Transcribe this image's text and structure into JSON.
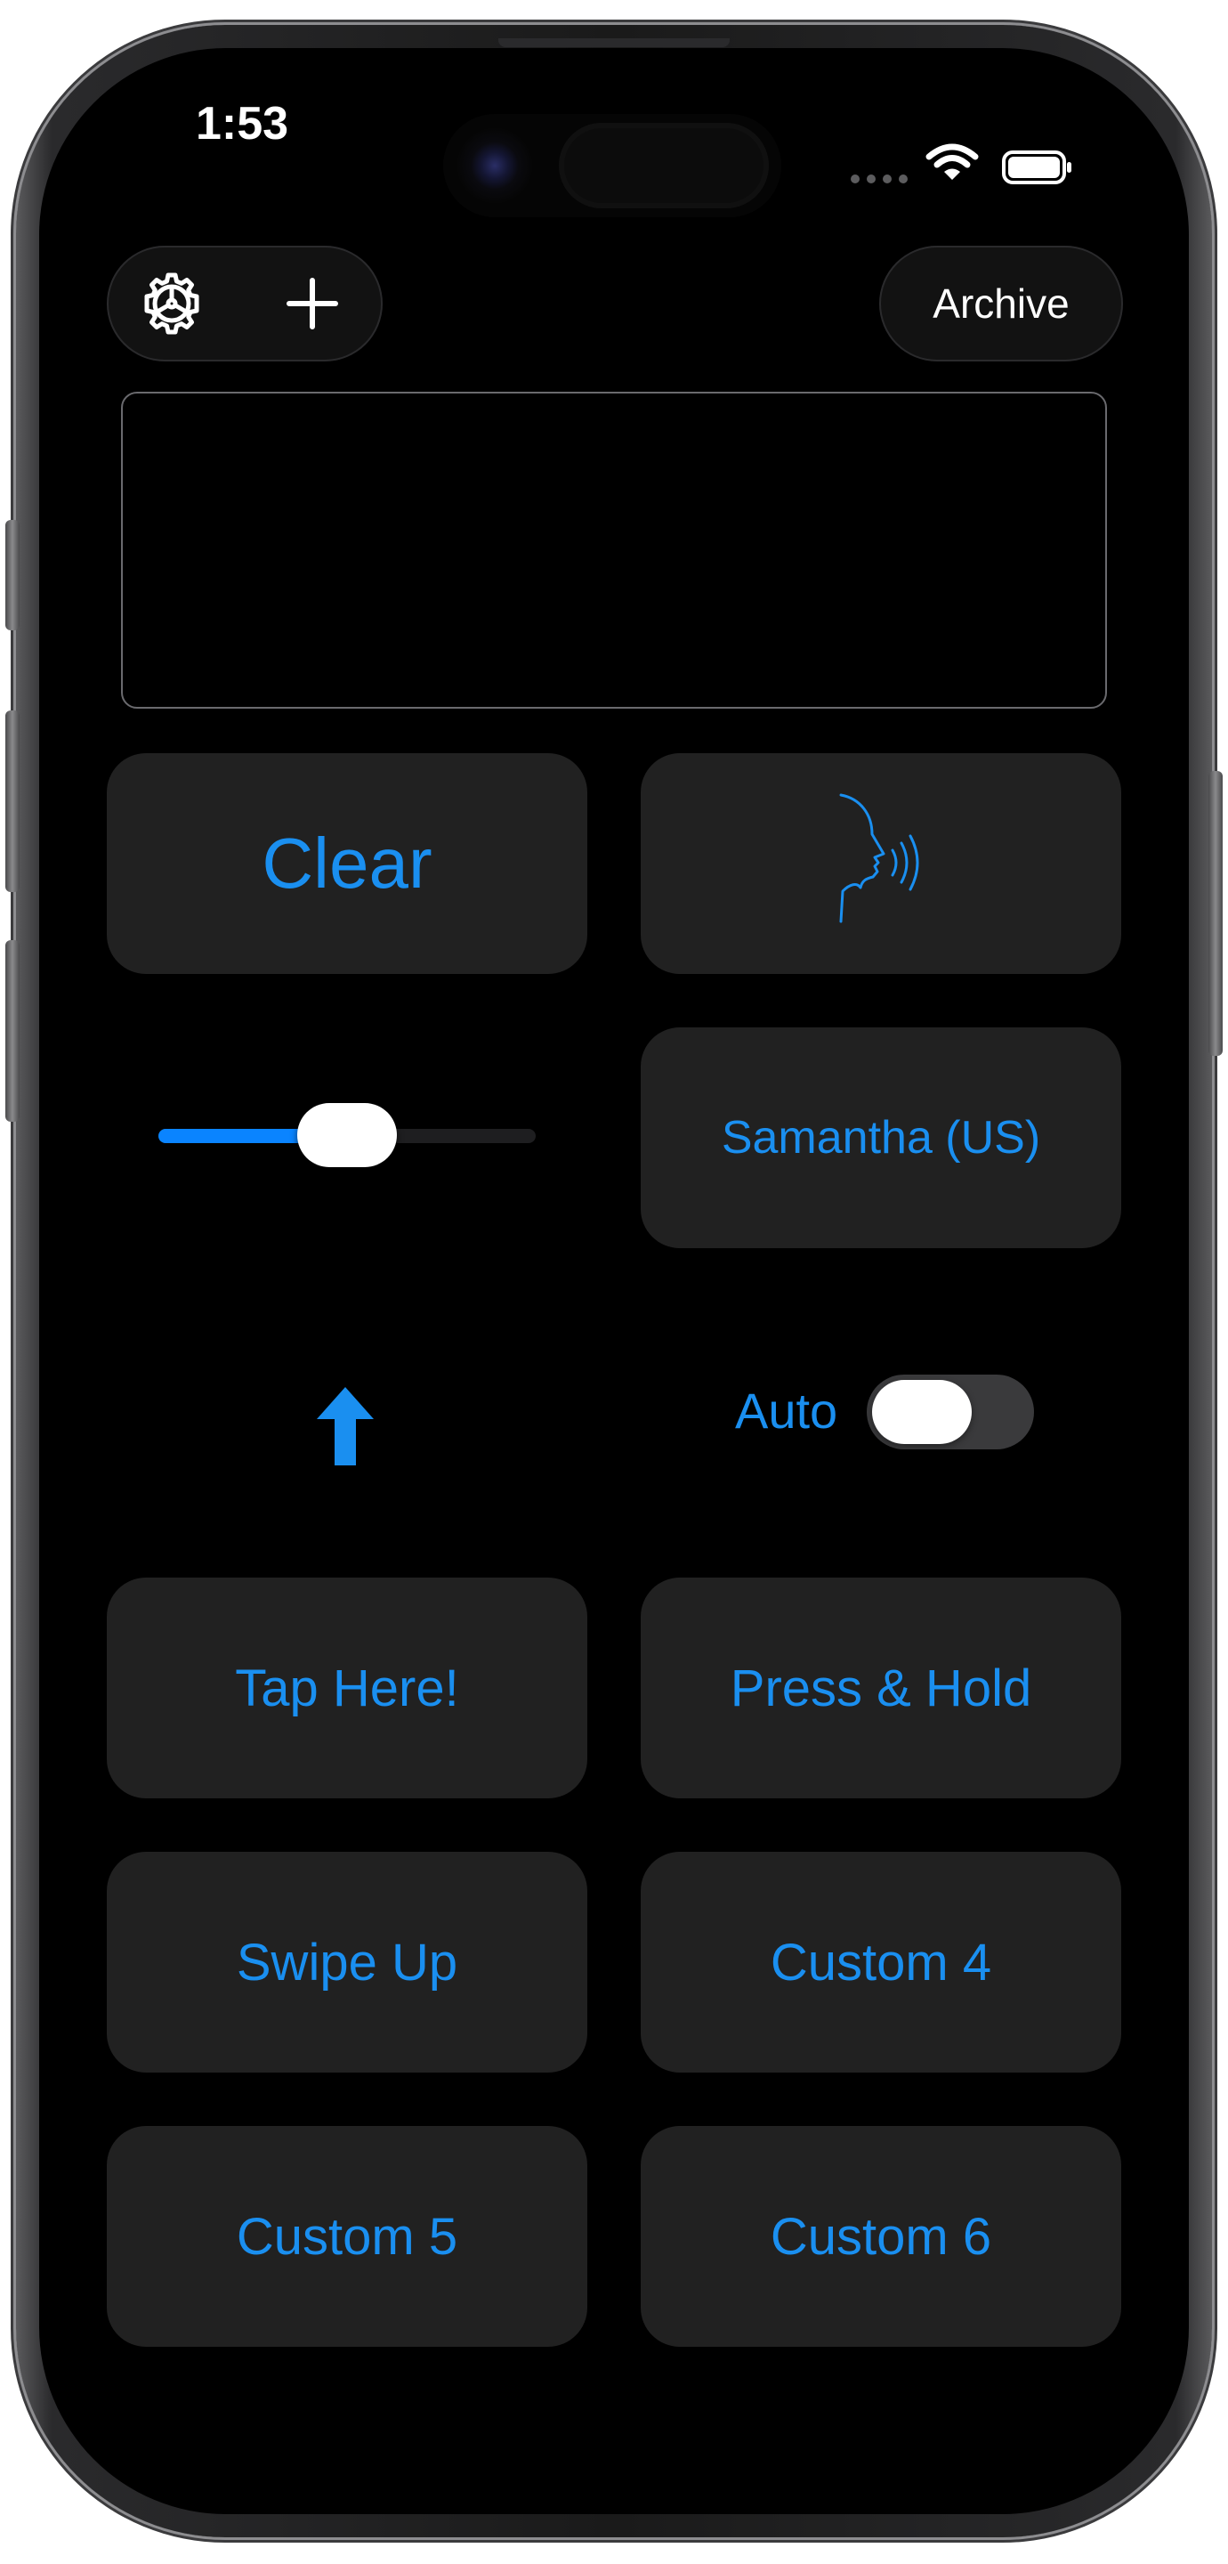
{
  "status_bar": {
    "time": "1:53"
  },
  "toolbar": {
    "settings_icon": "gear-icon",
    "add_icon": "plus-icon",
    "archive_label": "Archive"
  },
  "text_area": {
    "value": ""
  },
  "buttons": {
    "clear_label": "Clear",
    "speak_icon": "speaking-head-icon",
    "voice_label": "Samantha (US)",
    "tap_label": "Tap Here!",
    "press_hold_label": "Press & Hold",
    "swipe_up_label": "Swipe Up",
    "custom4_label": "Custom 4",
    "custom5_label": "Custom 5",
    "custom6_label": "Custom 6"
  },
  "speech_rate_slider": {
    "value": 0.5
  },
  "swipe_indicator": {
    "icon": "up-arrow-icon"
  },
  "auto_toggle": {
    "label": "Auto",
    "on": false
  },
  "colors": {
    "accent": "#1a8ff0",
    "background": "#000000",
    "tile": "#212121",
    "toggle_off": "#3a3a3c"
  }
}
